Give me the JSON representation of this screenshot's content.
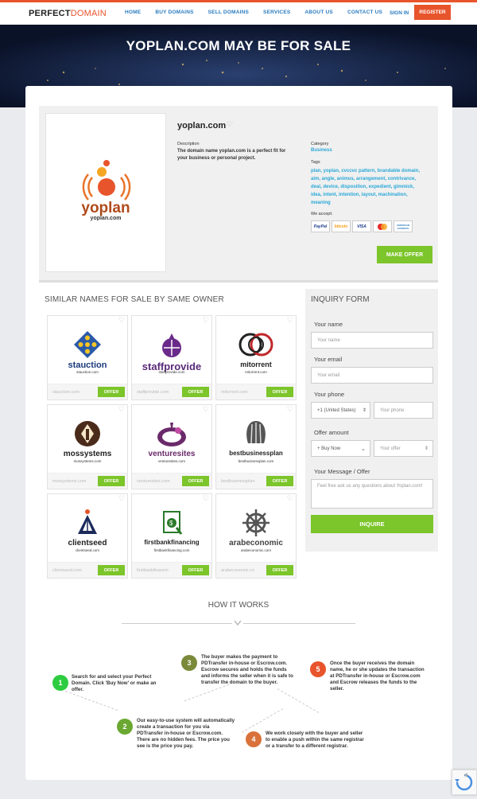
{
  "brand": {
    "part1": "PERFECT",
    "part2": "DOMAIN"
  },
  "nav": [
    "HOME",
    "BUY DOMAINS",
    "SELL DOMAINS",
    "SERVICES",
    "ABOUT US",
    "CONTACT US"
  ],
  "auth": {
    "signin": "SIGN IN",
    "register": "REGISTER"
  },
  "hero": {
    "title": "YOPLAN.COM MAY BE FOR SALE"
  },
  "domain": {
    "name": "yoplan.com",
    "logo_text": "yoplan",
    "logo_sub": "yoplan.com",
    "description_label": "Description",
    "description": "The domain name yoplan.com is a perfect fit for your business or personal project.",
    "category_label": "Category",
    "category": "Business",
    "tags_label": "Tags",
    "tags": "plan, yoplan, cvccvc pattern, brandable domain, aim, angle, animus, arrangement, contrivance, deal, device, disposition, expedient, gimmick, idea, intent, intention, layout, machination, meaning",
    "accept_label": "We accept:",
    "payments": [
      "PayPal",
      "bitcoin",
      "VISA",
      "MC",
      "AMERICAN EXPRESS"
    ],
    "make_offer": "MAKE OFFER"
  },
  "similar": {
    "title": "SIMILAR NAMES FOR SALE BY SAME OWNER",
    "offer_label": "OFFER",
    "items": [
      {
        "name": "stauction",
        "sub": "stauction.com",
        "domain": "stauction.com",
        "color": "#1a3a7a"
      },
      {
        "name": "staffprovide",
        "sub": "staffprovide.com",
        "domain": "staffprovide.com",
        "color": "#6a2a8a"
      },
      {
        "name": "mitorrent",
        "sub": "mitorrent.com",
        "domain": "mitorrent.com",
        "color": "#222"
      },
      {
        "name": "mossystems",
        "sub": "mossystems.com",
        "domain": "mossystems.com",
        "color": "#222"
      },
      {
        "name": "venturesites",
        "sub": "venturesites.com",
        "domain": "venturesites.com",
        "color": "#6a2a6a"
      },
      {
        "name": "bestbusinessplan",
        "sub": "bestbusinessplan.com",
        "domain": "bestbusinessplan",
        "color": "#222"
      },
      {
        "name": "clientseed",
        "sub": "clientseed.com",
        "domain": "clientseed.com",
        "color": "#222"
      },
      {
        "name": "firstbankfinancing",
        "sub": "firstbankfinancing.com",
        "domain": "firstbankfinancin",
        "color": "#222"
      },
      {
        "name": "arabeconomic",
        "sub": "arabeconomic.com",
        "domain": "arabeconomic.co",
        "color": "#222"
      }
    ]
  },
  "inquiry": {
    "title": "INQUIRY FORM",
    "name_label": "Your name",
    "name_placeholder": "Your name",
    "email_label": "Your email",
    "email_placeholder": "Your email",
    "phone_label": "Your phone",
    "phone_country": "+1 (United States)",
    "phone_placeholder": "Your phone",
    "offer_label": "Offer amount",
    "offer_type": "+ Buy Now",
    "offer_placeholder": "Your offer",
    "message_label": "Your Message / Offer",
    "message_placeholder": "Feel free ask us any questions about Yoplan.com!",
    "submit": "INQUIRE"
  },
  "how": {
    "title": "HOW IT WORKS",
    "steps": [
      {
        "n": "1",
        "text": "Search for and select your Perfect Domain. Click 'Buy Now' or make an offer.",
        "color": "#2ecc40"
      },
      {
        "n": "2",
        "text": "Our easy-to-use system will automatically create a transaction for you via PDTransfer in-house or Escrow.com. There are no hidden fees. The price you see is the price you pay.",
        "color": "#6aa832"
      },
      {
        "n": "3",
        "text": "The buyer makes the payment to PDTransfer in-house or Escrow.com. Escrow secures and holds the funds and informs the seller when it is safe to transfer the domain to the buyer.",
        "color": "#7a8a3a"
      },
      {
        "n": "4",
        "text": "We work closely with the buyer and seller to enable a push within the same registrar or a transfer to a different registrar.",
        "color": "#d9713a"
      },
      {
        "n": "5",
        "text": "Once the buyer receives the domain name, he or she updates the transaction at PDTransfer in-house or Escrow.com and Escrow releases the funds to the seller.",
        "color": "#e8542b"
      }
    ]
  }
}
